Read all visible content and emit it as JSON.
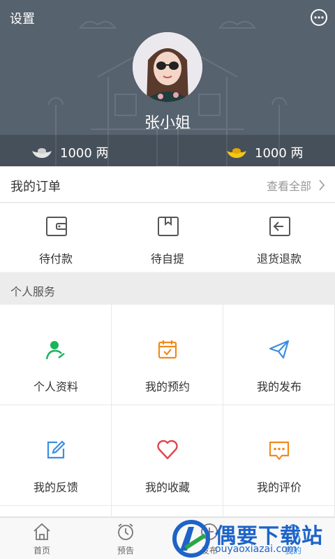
{
  "header": {
    "settings_label": "设置",
    "username": "张小姐",
    "silver_amount": "1000 两",
    "gold_amount": "1000 两"
  },
  "orders": {
    "title": "我的订单",
    "view_all": "查看全部",
    "items": [
      {
        "label": "待付款",
        "icon": "wallet-icon"
      },
      {
        "label": "待自提",
        "icon": "pickup-box-icon"
      },
      {
        "label": "退货退款",
        "icon": "return-icon"
      }
    ]
  },
  "services": {
    "title": "个人服务",
    "items": [
      {
        "label": "个人资料",
        "icon": "profile-icon",
        "color": "#1bb35c"
      },
      {
        "label": "我的预约",
        "icon": "calendar-check-icon",
        "color": "#f08a1c"
      },
      {
        "label": "我的发布",
        "icon": "paper-plane-icon",
        "color": "#3c8ee0"
      },
      {
        "label": "我的反馈",
        "icon": "edit-icon",
        "color": "#3c8ee0"
      },
      {
        "label": "我的收藏",
        "icon": "heart-icon",
        "color": "#e0464f"
      },
      {
        "label": "我的评价",
        "icon": "comment-icon",
        "color": "#f08a1c"
      }
    ]
  },
  "bottom_nav": {
    "items": [
      {
        "label": "首页",
        "icon": "home-icon"
      },
      {
        "label": "预告",
        "icon": "alarm-clock-icon"
      },
      {
        "label": "发布",
        "icon": "publish-icon"
      },
      {
        "label": "",
        "icon": "nav-blank"
      },
      {
        "label": "我的",
        "icon": "user-icon"
      }
    ]
  },
  "watermark": {
    "title": "偶要下载站",
    "url": "ouyaoxiazai.com"
  }
}
